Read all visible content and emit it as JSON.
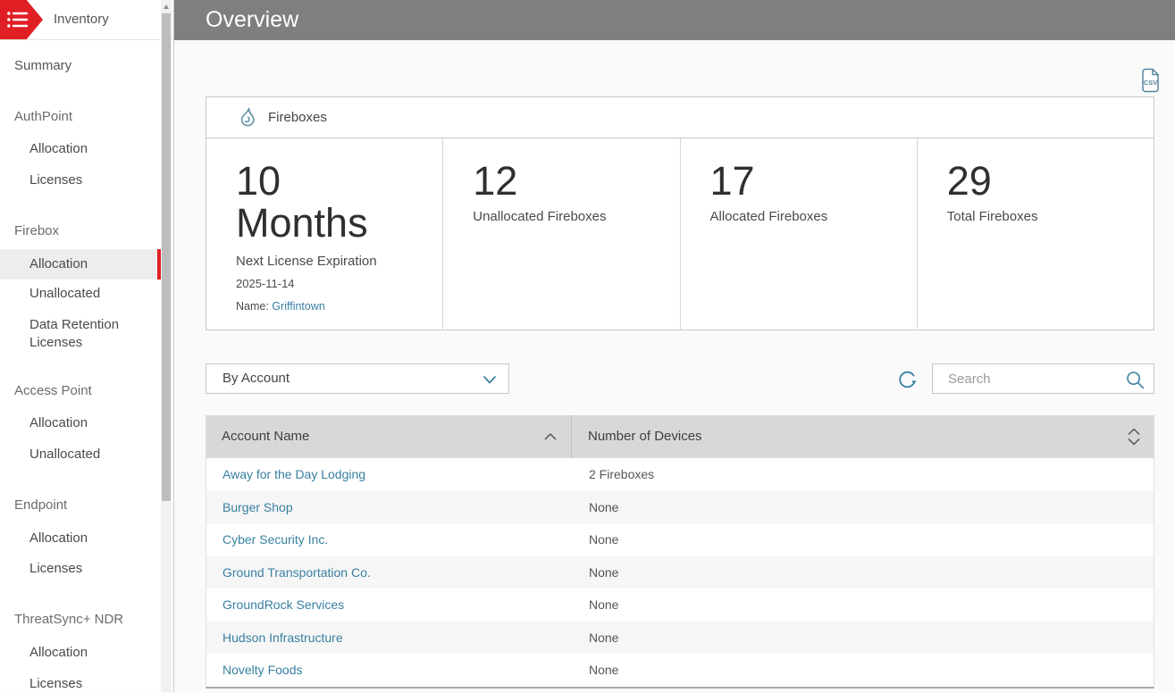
{
  "sidebar": {
    "title": "Inventory",
    "items": [
      {
        "label": "Summary",
        "type": "top"
      },
      {
        "label": "AuthPoint",
        "type": "section"
      },
      {
        "label": "Allocation",
        "type": "sub"
      },
      {
        "label": "Licenses",
        "type": "sub"
      },
      {
        "label": "Firebox",
        "type": "section"
      },
      {
        "label": "Allocation",
        "type": "sub",
        "selected": true
      },
      {
        "label": "Unallocated",
        "type": "sub"
      },
      {
        "label": "Data Retention Licenses",
        "type": "sub"
      },
      {
        "label": "Access Point",
        "type": "section"
      },
      {
        "label": "Allocation",
        "type": "sub"
      },
      {
        "label": "Unallocated",
        "type": "sub"
      },
      {
        "label": "Endpoint",
        "type": "section"
      },
      {
        "label": "Allocation",
        "type": "sub"
      },
      {
        "label": "Licenses",
        "type": "sub"
      },
      {
        "label": "ThreatSync+ NDR",
        "type": "section"
      },
      {
        "label": "Allocation",
        "type": "sub"
      },
      {
        "label": "Licenses",
        "type": "sub"
      }
    ]
  },
  "topbar": {
    "title": "Overview"
  },
  "toolbar": {
    "export_icon": "csv-file-icon"
  },
  "card": {
    "title": "Fireboxes",
    "icon": "firebox-flame-icon",
    "expiration": {
      "value": "10",
      "unit": "Months",
      "label": "Next License Expiration",
      "date": "2025-11-14",
      "name_label": "Name:",
      "name_link": "Griffintown"
    },
    "cells": [
      {
        "value": "12",
        "label": "Unallocated Fireboxes"
      },
      {
        "value": "17",
        "label": "Allocated Fireboxes"
      },
      {
        "value": "29",
        "label": "Total Fireboxes"
      }
    ]
  },
  "filter": {
    "dropdown_value": "By Account",
    "search_placeholder": "Search",
    "search_value": ""
  },
  "table": {
    "columns": [
      {
        "label": "Account Name",
        "sort": "asc"
      },
      {
        "label": "Number of Devices",
        "sort": "none"
      }
    ],
    "rows": [
      {
        "account": "Away for the Day Lodging",
        "devices": "2 Fireboxes"
      },
      {
        "account": "Burger Shop",
        "devices": "None"
      },
      {
        "account": "Cyber Security Inc.",
        "devices": "None"
      },
      {
        "account": "Ground Transportation Co.",
        "devices": "None"
      },
      {
        "account": "GroundRock Services",
        "devices": "None"
      },
      {
        "account": "Hudson Infrastructure",
        "devices": "None"
      },
      {
        "account": "Novelty Foods",
        "devices": "None"
      }
    ]
  },
  "colors": {
    "accent_red": "#e01f25",
    "topbar_gray": "#7f7f7f",
    "link_teal": "#3880a1",
    "icon_teal": "#55859c",
    "table_header_bg": "#d8d8d8"
  }
}
